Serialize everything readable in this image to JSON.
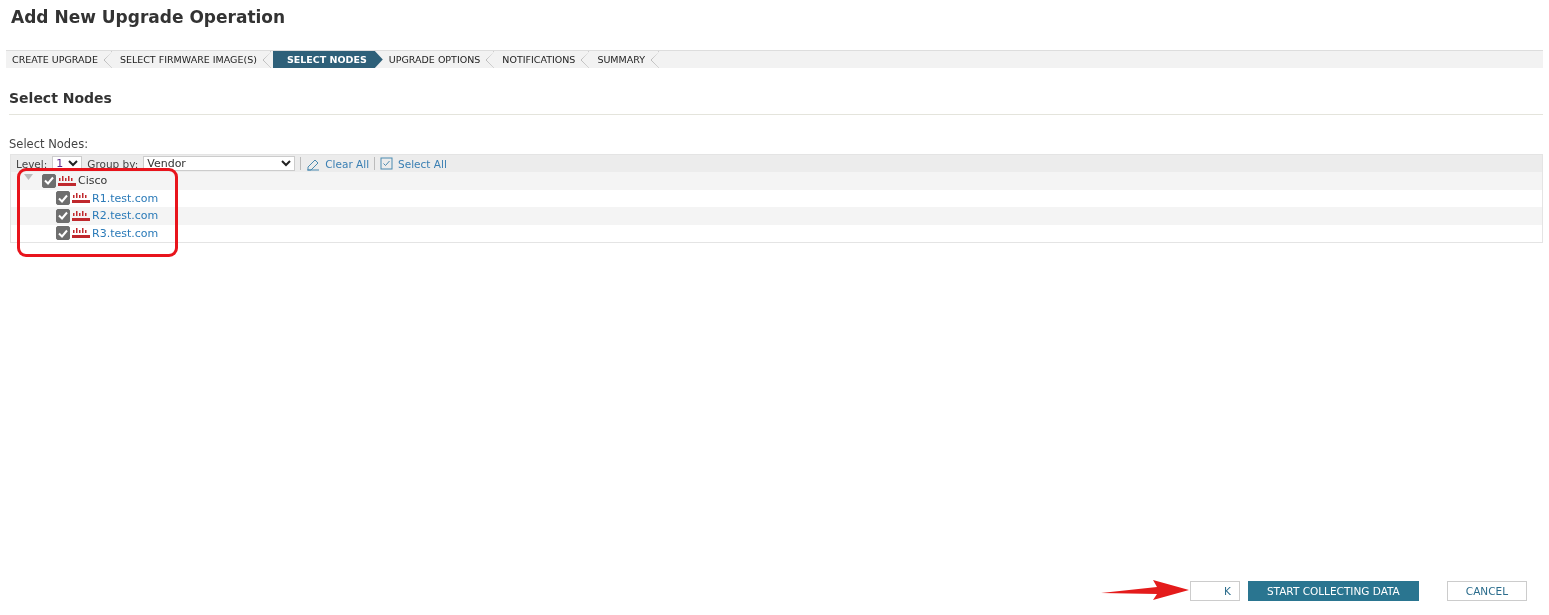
{
  "title": "Add New Upgrade Operation",
  "steps": [
    {
      "label": "CREATE UPGRADE",
      "selected": false
    },
    {
      "label": "SELECT FIRMWARE IMAGE(S)",
      "selected": false
    },
    {
      "label": "SELECT NODES",
      "selected": true
    },
    {
      "label": "UPGRADE OPTIONS",
      "selected": false
    },
    {
      "label": "NOTIFICATIONS",
      "selected": false
    },
    {
      "label": "SUMMARY",
      "selected": false
    }
  ],
  "section_title": "Select Nodes",
  "field_label": "Select Nodes:",
  "toolbar": {
    "level_label": "Level:",
    "level_value": "1",
    "group_label": "Group by:",
    "group_value": "Vendor",
    "clear_all": "Clear All",
    "select_all": "Select All"
  },
  "tree": [
    {
      "label": "Cisco",
      "checked": true,
      "expanded": true,
      "children": [
        {
          "label": "R1.test.com",
          "checked": true
        },
        {
          "label": "R2.test.com",
          "checked": true
        },
        {
          "label": "R3.test.com",
          "checked": true
        }
      ]
    }
  ],
  "buttons": [
    {
      "label": "K",
      "kind": "secondary"
    },
    {
      "label": "START COLLECTING DATA",
      "kind": "primary"
    },
    {
      "label": "CANCEL",
      "kind": "secondary"
    }
  ]
}
